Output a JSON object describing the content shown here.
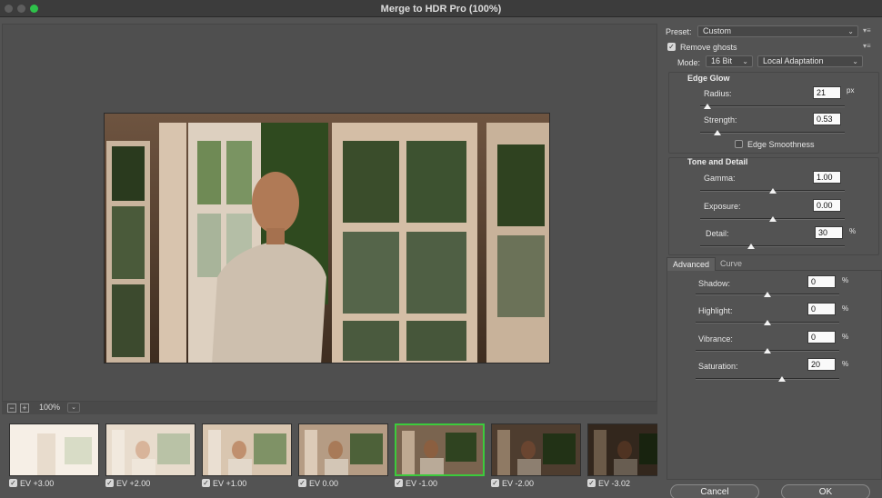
{
  "window": {
    "title": "Merge to HDR Pro (100%)"
  },
  "preview": {
    "zoom": "100%"
  },
  "thumbnails": [
    {
      "label": "EV +3.00",
      "checked": true
    },
    {
      "label": "EV +2.00",
      "checked": true
    },
    {
      "label": "EV +1.00",
      "checked": true
    },
    {
      "label": "EV 0.00",
      "checked": true
    },
    {
      "label": "EV -1.00",
      "checked": true
    },
    {
      "label": "EV -2.00",
      "checked": true
    },
    {
      "label": "EV -3.02",
      "checked": true
    }
  ],
  "panel": {
    "preset_label": "Preset:",
    "preset_value": "Custom",
    "remove_ghosts": "Remove ghosts",
    "mode_label": "Mode:",
    "bit_depth": "16 Bit",
    "method": "Local Adaptation",
    "edge_glow": {
      "title": "Edge Glow",
      "radius_label": "Radius:",
      "radius_value": "21",
      "radius_unit": "px",
      "radius_fraction": 0.05,
      "strength_label": "Strength:",
      "strength_value": "0.53",
      "strength_fraction": 0.12,
      "edge_smoothness": "Edge Smoothness"
    },
    "tone_detail": {
      "title": "Tone and Detail",
      "gamma_label": "Gamma:",
      "gamma_value": "1.00",
      "gamma_fraction": 0.5,
      "exposure_label": "Exposure:",
      "exposure_value": "0.00",
      "exposure_fraction": 0.5,
      "detail_label": "Detail:",
      "detail_value": "30",
      "detail_unit": "%",
      "detail_fraction": 0.35
    },
    "tabs": {
      "advanced": "Advanced",
      "curve": "Curve"
    },
    "advanced": {
      "shadow_label": "Shadow:",
      "shadow_value": "0",
      "shadow_fraction": 0.5,
      "highlight_label": "Highlight:",
      "highlight_value": "0",
      "highlight_fraction": 0.5,
      "vibrance_label": "Vibrance:",
      "vibrance_value": "0",
      "vibrance_fraction": 0.5,
      "saturation_label": "Saturation:",
      "saturation_value": "20",
      "saturation_fraction": 0.6,
      "unit": "%"
    },
    "cancel": "Cancel",
    "ok": "OK"
  }
}
